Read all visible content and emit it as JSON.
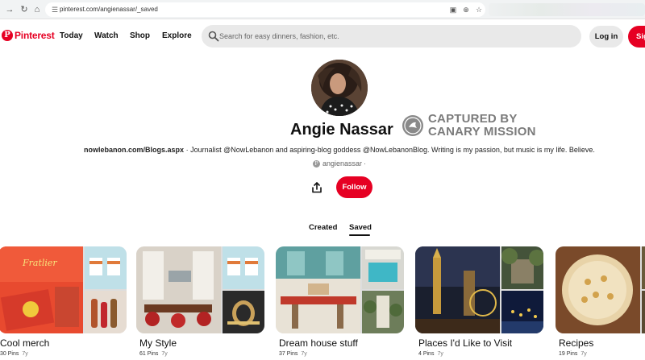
{
  "browser": {
    "url": "pinterest.com/angienassar/_saved",
    "back_icon": "arrow-left-icon",
    "reload_icon": "reload-icon",
    "home_icon": "home-icon"
  },
  "header": {
    "logo_text": "Pinterest",
    "nav": [
      "Today",
      "Watch",
      "Shop",
      "Explore"
    ],
    "search_placeholder": "Search for easy dinners, fashion, etc.",
    "login_label": "Log in",
    "signup_label": "Sig"
  },
  "profile": {
    "name": "Angie Nassar",
    "watermark_line1": "CAPTURED BY",
    "watermark_line2": "CANARY MISSION",
    "bio_link": "nowlebanon.com/Blogs.aspx",
    "bio_text": " · Journalist @NowLebanon and aspiring-blog goddess @NowLebanonBlog. Writing is my passion, but music is my life. Believe.",
    "handle": "angienassar",
    "handle_suffix": "·",
    "follow_label": "Follow"
  },
  "tabs": [
    {
      "label": "Created",
      "active": false
    },
    {
      "label": "Saved",
      "active": true
    }
  ],
  "boards": [
    {
      "title": "Cool merch",
      "pins": "30 Pins",
      "age": "7y"
    },
    {
      "title": "My Style",
      "pins": "61 Pins",
      "age": "7y"
    },
    {
      "title": "Dream house stuff",
      "pins": "37 Pins",
      "age": "7y"
    },
    {
      "title": "Places I'd Like to Visit",
      "pins": "4 Pins",
      "age": "7y"
    },
    {
      "title": "Recipes",
      "pins": "19 Pins",
      "age": "7y"
    }
  ],
  "colors": {
    "brand": "#e60023",
    "search_bg": "#e9e9e9"
  }
}
